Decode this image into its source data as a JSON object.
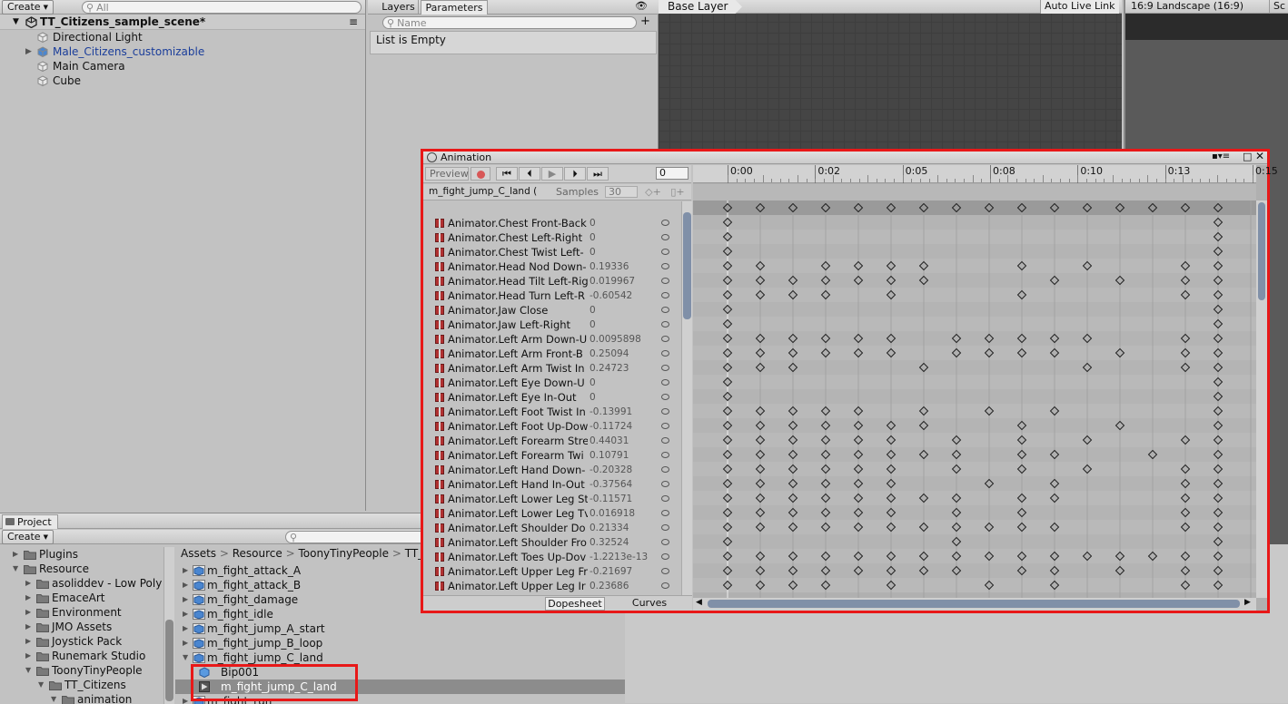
{
  "hierarchy": {
    "create_label": "Create",
    "search_placeholder": "All",
    "scene_name": "TT_Citizens_sample_scene*",
    "items": [
      {
        "label": "Directional Light",
        "color": "#111111",
        "expandable": false
      },
      {
        "label": "Male_Citizens_customizable",
        "color": "#1a3d9a",
        "expandable": true
      },
      {
        "label": "Main Camera",
        "color": "#111111",
        "expandable": false
      },
      {
        "label": "Cube",
        "color": "#111111",
        "expandable": false
      }
    ]
  },
  "animator": {
    "tab_layers": "Layers",
    "tab_parameters": "Parameters",
    "name_placeholder": "Name",
    "list_empty": "List is Empty",
    "breadcrumb": "Base Layer",
    "auto_live_link": "Auto Live Link"
  },
  "game": {
    "aspect": "16:9 Landscape (16:9)",
    "scale_label": "Sc"
  },
  "animation": {
    "title": "Animation",
    "preview_label": "Preview",
    "frame_value": "0",
    "clip_name": "m_fight_jump_C_land (I",
    "samples_label": "Samples",
    "samples_value": "30",
    "tab_dopesheet": "Dopesheet",
    "tab_curves": "Curves",
    "timeline_ticks": [
      "0:00",
      "0:02",
      "0:05",
      "0:08",
      "0:10",
      "0:13",
      "0:15"
    ],
    "properties": [
      {
        "name": "Animator.Chest Front-Back",
        "value": "0"
      },
      {
        "name": "Animator.Chest Left-Right",
        "value": "0"
      },
      {
        "name": "Animator.Chest Twist Left-",
        "value": "0"
      },
      {
        "name": "Animator.Head Nod Down-",
        "value": "0.19336"
      },
      {
        "name": "Animator.Head Tilt Left-Rig",
        "value": "0.019967"
      },
      {
        "name": "Animator.Head Turn Left-R",
        "value": "-0.60542"
      },
      {
        "name": "Animator.Jaw Close",
        "value": "0"
      },
      {
        "name": "Animator.Jaw Left-Right",
        "value": "0"
      },
      {
        "name": "Animator.Left Arm Down-U",
        "value": "0.0095898"
      },
      {
        "name": "Animator.Left Arm Front-B",
        "value": "0.25094"
      },
      {
        "name": "Animator.Left Arm Twist In",
        "value": "0.24723"
      },
      {
        "name": "Animator.Left Eye Down-U",
        "value": "0"
      },
      {
        "name": "Animator.Left Eye In-Out",
        "value": "0"
      },
      {
        "name": "Animator.Left Foot Twist In",
        "value": "-0.13991"
      },
      {
        "name": "Animator.Left Foot Up-Dow",
        "value": "-0.11724"
      },
      {
        "name": "Animator.Left Forearm Stre",
        "value": "0.44031"
      },
      {
        "name": "Animator.Left Forearm Twi",
        "value": "0.10791"
      },
      {
        "name": "Animator.Left Hand Down-",
        "value": "-0.20328"
      },
      {
        "name": "Animator.Left Hand In-Out",
        "value": "-0.37564"
      },
      {
        "name": "Animator.Left Lower Leg St",
        "value": "-0.11571"
      },
      {
        "name": "Animator.Left Lower Leg Tv",
        "value": "0.016918"
      },
      {
        "name": "Animator.Left Shoulder Do",
        "value": "0.21334"
      },
      {
        "name": "Animator.Left Shoulder Fro",
        "value": "0.32524"
      },
      {
        "name": "Animator.Left Toes Up-Dov",
        "value": "-1.2213e-13"
      },
      {
        "name": "Animator.Left Upper Leg Fr",
        "value": "-0.21697"
      },
      {
        "name": "Animator.Left Upper Leg Ir",
        "value": "0.23686"
      }
    ]
  },
  "project": {
    "tab_label": "Project",
    "create_label": "Create",
    "breadcrumb": [
      "Assets",
      "Resource",
      "ToonyTinyPeople",
      "TT_C"
    ],
    "tree": [
      {
        "label": "Plugins",
        "indent": 1,
        "open": false
      },
      {
        "label": "Resource",
        "indent": 1,
        "open": true
      },
      {
        "label": "asoliddev - Low Poly",
        "indent": 2,
        "open": false
      },
      {
        "label": "EmaceArt",
        "indent": 2,
        "open": false
      },
      {
        "label": "Environment",
        "indent": 2,
        "open": false
      },
      {
        "label": "JMO Assets",
        "indent": 2,
        "open": false
      },
      {
        "label": "Joystick Pack",
        "indent": 2,
        "open": false
      },
      {
        "label": "Runemark Studio",
        "indent": 2,
        "open": false
      },
      {
        "label": "ToonyTinyPeople",
        "indent": 2,
        "open": true
      },
      {
        "label": "TT_Citizens",
        "indent": 3,
        "open": true
      },
      {
        "label": "animation",
        "indent": 4,
        "open": true
      }
    ],
    "assets": [
      {
        "label": "m_fight_attack_A",
        "type": "model"
      },
      {
        "label": "m_fight_attack_B",
        "type": "model"
      },
      {
        "label": "m_fight_damage",
        "type": "model"
      },
      {
        "label": "m_fight_idle",
        "type": "model"
      },
      {
        "label": "m_fight_jump_A_start",
        "type": "model"
      },
      {
        "label": "m_fight_jump_B_loop",
        "type": "model"
      },
      {
        "label": "m_fight_jump_C_land",
        "type": "model-open"
      },
      {
        "label": "Bip001",
        "type": "child-mesh"
      },
      {
        "label": "m_fight_jump_C_land",
        "type": "child-clip"
      },
      {
        "label": "m_fight_run",
        "type": "model"
      }
    ]
  }
}
